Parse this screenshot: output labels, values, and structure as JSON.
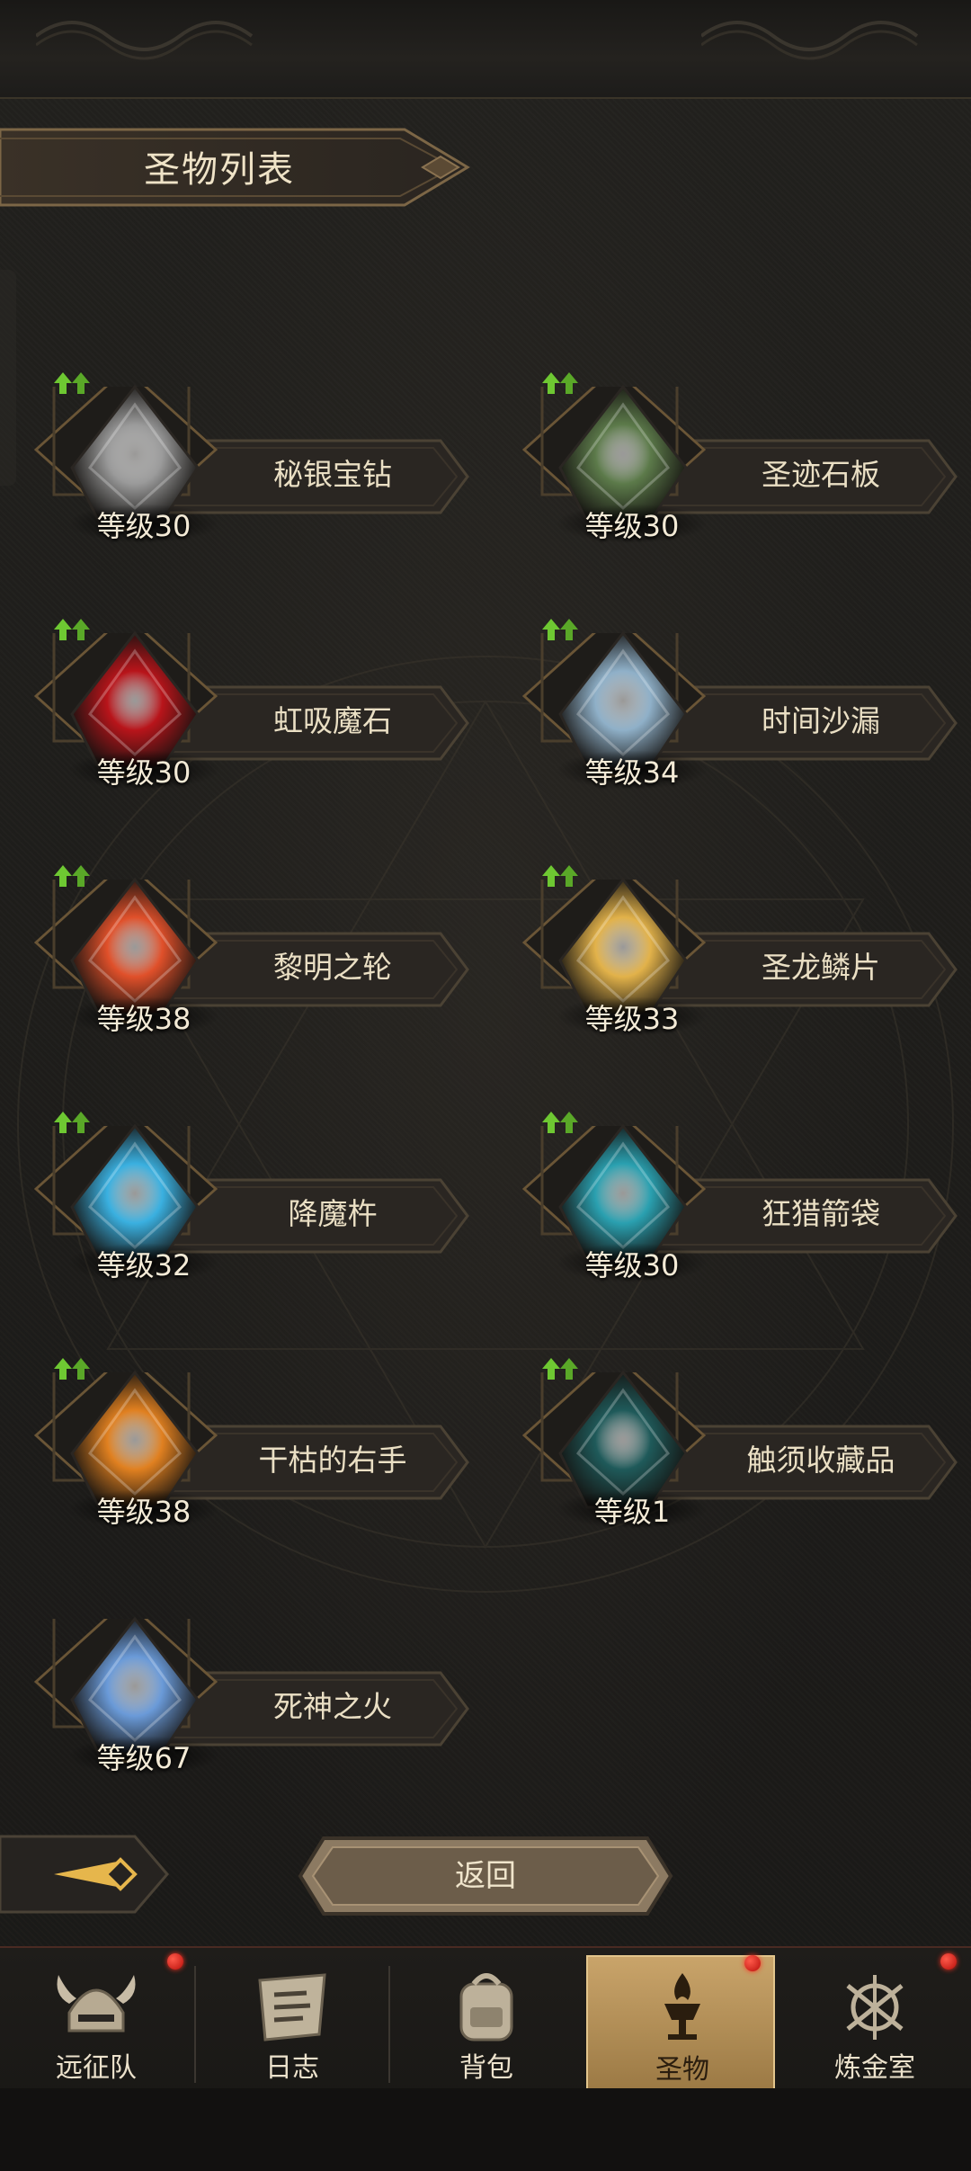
{
  "header": {
    "title": "圣物列表"
  },
  "relics": [
    {
      "name": "秘银宝钻",
      "level": "等级30",
      "upgrade": true,
      "icon": "mithril-diamond-icon",
      "color": "#9a9a9a"
    },
    {
      "name": "圣迹石板",
      "level": "等级30",
      "upgrade": true,
      "icon": "sacred-stone-slab-icon",
      "color": "#5c7a4a"
    },
    {
      "name": "虹吸魔石",
      "level": "等级30",
      "upgrade": true,
      "icon": "siphon-magic-stone-icon",
      "color": "#b8141a"
    },
    {
      "name": "时间沙漏",
      "level": "等级34",
      "upgrade": true,
      "icon": "hourglass-icon",
      "color": "#8fb0c8"
    },
    {
      "name": "黎明之轮",
      "level": "等级38",
      "upgrade": true,
      "icon": "dawn-wheel-icon",
      "color": "#e0502a"
    },
    {
      "name": "圣龙鳞片",
      "level": "等级33",
      "upgrade": true,
      "icon": "dragon-scale-icon",
      "color": "#e2b24a"
    },
    {
      "name": "降魔杵",
      "level": "等级32",
      "upgrade": true,
      "icon": "vajra-scepter-icon",
      "color": "#3ab0e0"
    },
    {
      "name": "狂猎箭袋",
      "level": "等级30",
      "upgrade": true,
      "icon": "quiver-icon",
      "color": "#2aa0b0"
    },
    {
      "name": "干枯的右手",
      "level": "等级38",
      "upgrade": true,
      "icon": "withered-hand-icon",
      "color": "#e08020"
    },
    {
      "name": "触须收藏品",
      "level": "等级1",
      "upgrade": true,
      "icon": "tentacle-icon",
      "color": "#1f5a5a"
    },
    {
      "name": "死神之火",
      "level": "等级67",
      "upgrade": false,
      "icon": "death-fire-icon",
      "color": "#6a9ad8"
    }
  ],
  "controls": {
    "return_label": "返回"
  },
  "nav": [
    {
      "label": "远征队",
      "icon": "viking-helmet-icon",
      "badge": true,
      "active": false
    },
    {
      "label": "日志",
      "icon": "journal-scroll-icon",
      "badge": false,
      "active": false
    },
    {
      "label": "背包",
      "icon": "backpack-icon",
      "badge": false,
      "active": false
    },
    {
      "label": "圣物",
      "icon": "torch-chalice-icon",
      "badge": true,
      "active": true
    },
    {
      "label": "炼金室",
      "icon": "alchemy-icon",
      "badge": true,
      "active": false
    }
  ],
  "colors": {
    "accent_gold": "#c9a46a",
    "badge_red": "#d01810",
    "upgrade_green": "#6ec832"
  }
}
